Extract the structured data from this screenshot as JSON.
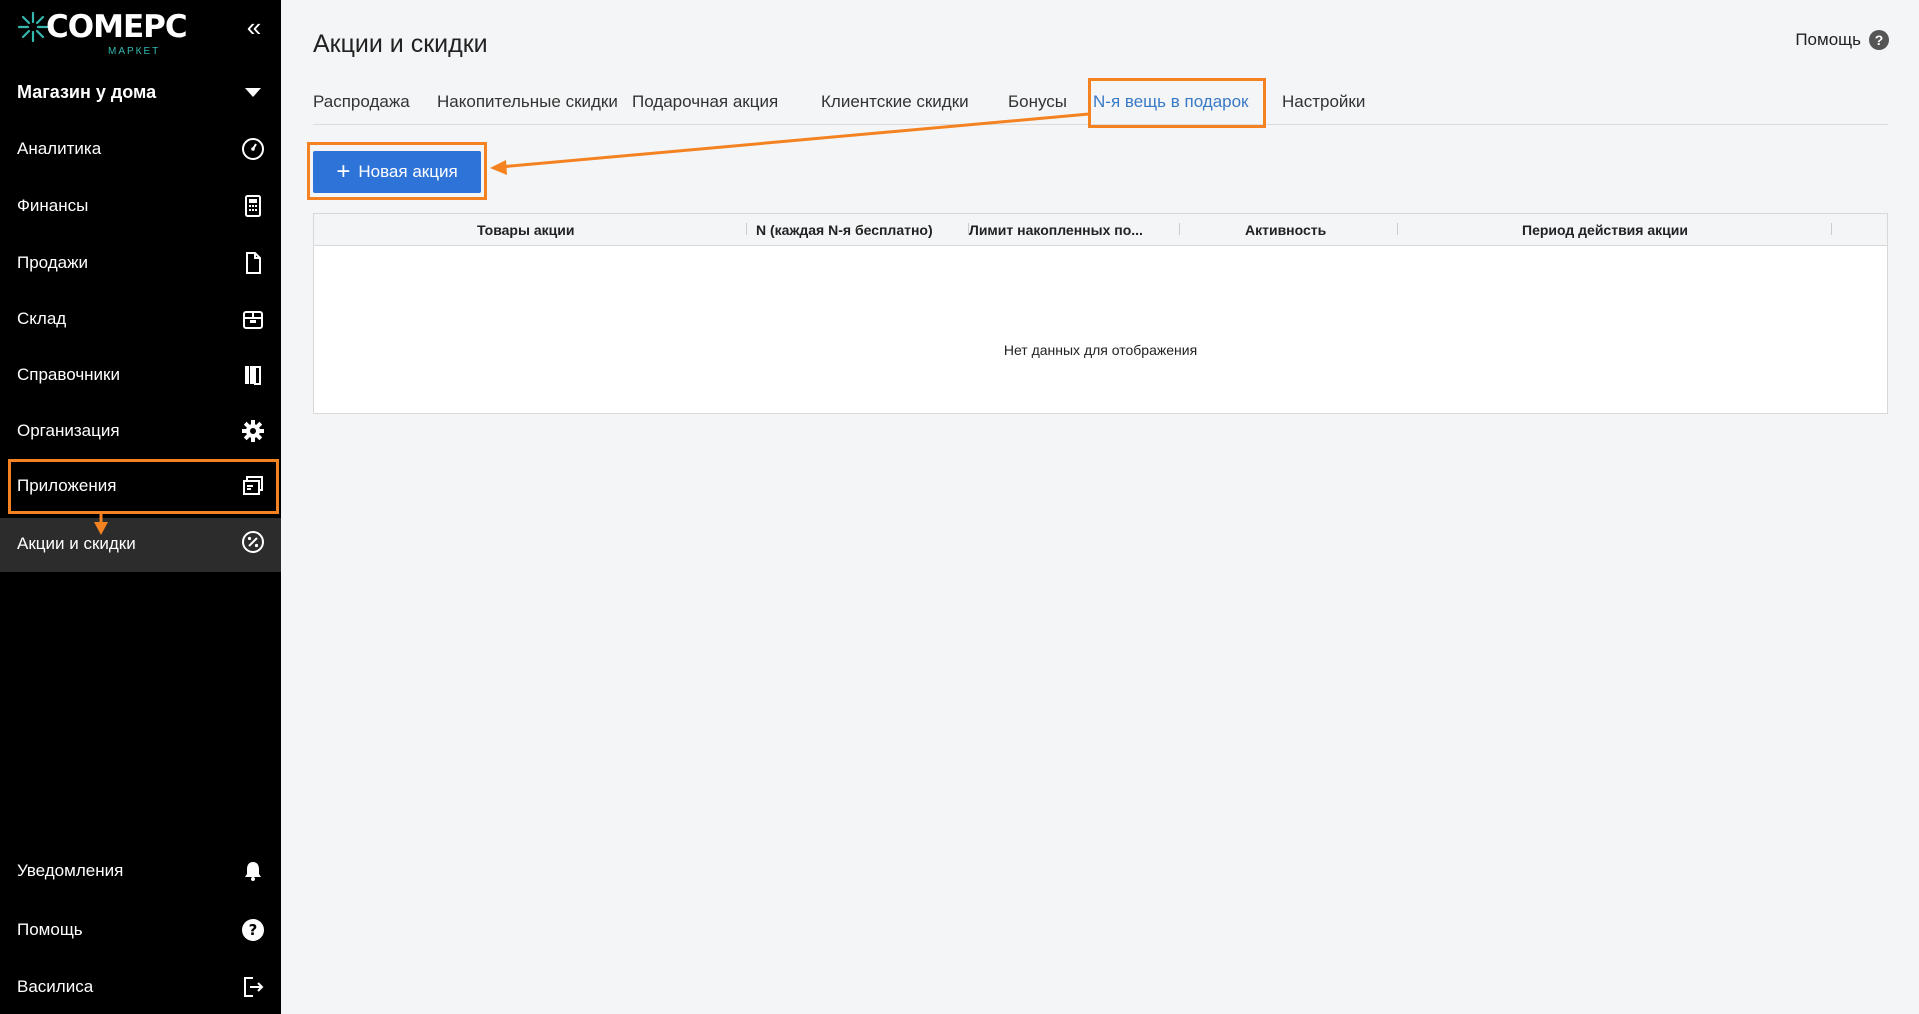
{
  "sidebar": {
    "brand": "COMEPC",
    "brand_sub": "МАРКЕТ",
    "store": "Магазин у дома",
    "items": [
      {
        "label": "Аналитика",
        "icon": "speedometer-icon"
      },
      {
        "label": "Финансы",
        "icon": "calculator-icon"
      },
      {
        "label": "Продажи",
        "icon": "document-icon"
      },
      {
        "label": "Склад",
        "icon": "warehouse-box-icon"
      },
      {
        "label": "Справочники",
        "icon": "books-icon"
      },
      {
        "label": "Организация",
        "icon": "gear-icon"
      },
      {
        "label": "Приложения",
        "icon": "apps-window-icon"
      },
      {
        "label": "Акции и скидки",
        "icon": "percent-badge-icon"
      }
    ],
    "bottom": [
      {
        "label": "Уведомления",
        "icon": "bell-icon"
      },
      {
        "label": "Помощь",
        "icon": "question-circle-icon"
      },
      {
        "label": "Василиса",
        "icon": "logout-icon"
      }
    ]
  },
  "header": {
    "title": "Акции и скидки",
    "help": "Помощь"
  },
  "tabs": [
    "Распродажа",
    "Накопительные скидки",
    "Подарочная акция",
    "Клиентские скидки",
    "Бонусы",
    "N-я вещь в подарок",
    "Настройки"
  ],
  "active_tab": "N-я вещь в подарок",
  "new_button": "Новая акция",
  "table": {
    "columns": [
      "Товары акции",
      "N (каждая N-я бесплатно)",
      "Лимит накопленных по...",
      "Активность",
      "Период действия акции"
    ],
    "empty": "Нет данных для отображения"
  },
  "colors": {
    "sidebar_bg": "#000000",
    "accent": "#2e74d8",
    "active_tab": "#3879c5",
    "annotation": "#f58220",
    "brand_teal": "#35b8b0"
  }
}
